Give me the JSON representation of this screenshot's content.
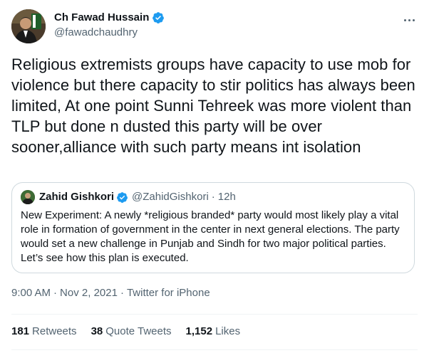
{
  "author": {
    "name": "Ch Fawad Hussain",
    "handle": "@fawadchaudhry",
    "verified_icon": "verified-badge-icon"
  },
  "more_icon": "more-options-icon",
  "tweet": {
    "text": "Religious extremists groups have capacity to use mob for violence but there capacity to stir politics has always been limited, At one point Sunni Tehreek was more violent than TLP but done n dusted this party will be over sooner,alliance with such party means int isolation"
  },
  "quote": {
    "name": "Zahid Gishkori",
    "handle": "@ZahidGishkori",
    "dot": "·",
    "time": "12h",
    "text": "New Experiment: A newly *religious branded* party would most likely play a vital role in formation of government in the center in next general elections. The party would set a new challenge in Punjab and Sindh for two major political parties. Let’s see how this plan is executed."
  },
  "meta": {
    "time": "9:00 AM",
    "date": "Nov 2, 2021",
    "separator": "·",
    "source": "Twitter for iPhone"
  },
  "stats": {
    "retweets": {
      "count": "181",
      "label": "Retweets"
    },
    "quotes": {
      "count": "38",
      "label": "Quote Tweets"
    },
    "likes": {
      "count": "1,152",
      "label": "Likes"
    }
  },
  "colors": {
    "text": "#0f1419",
    "secondary": "#536471",
    "verified": "#1d9bf0",
    "border": "#cfd9de"
  }
}
